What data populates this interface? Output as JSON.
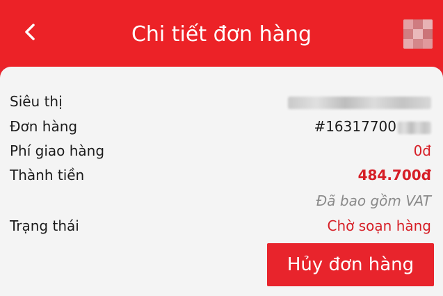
{
  "header": {
    "title": "Chi tiết đơn hàng",
    "back_icon": "chevron-left-icon",
    "background_color": "#ec2227"
  },
  "order": {
    "store_label": "Siêu thị",
    "order_label": "Đơn hàng",
    "order_value": "#16317700",
    "shipping_label": "Phí giao hàng",
    "shipping_value": "0đ",
    "total_label": "Thành tiền",
    "total_value": "484.700đ",
    "vat_note": "Đã bao gồm VAT",
    "status_label": "Trạng thái",
    "status_value": "Chờ soạn hàng"
  },
  "actions": {
    "cancel_label": "Hủy đơn hàng",
    "accent_color": "#e8242c"
  }
}
